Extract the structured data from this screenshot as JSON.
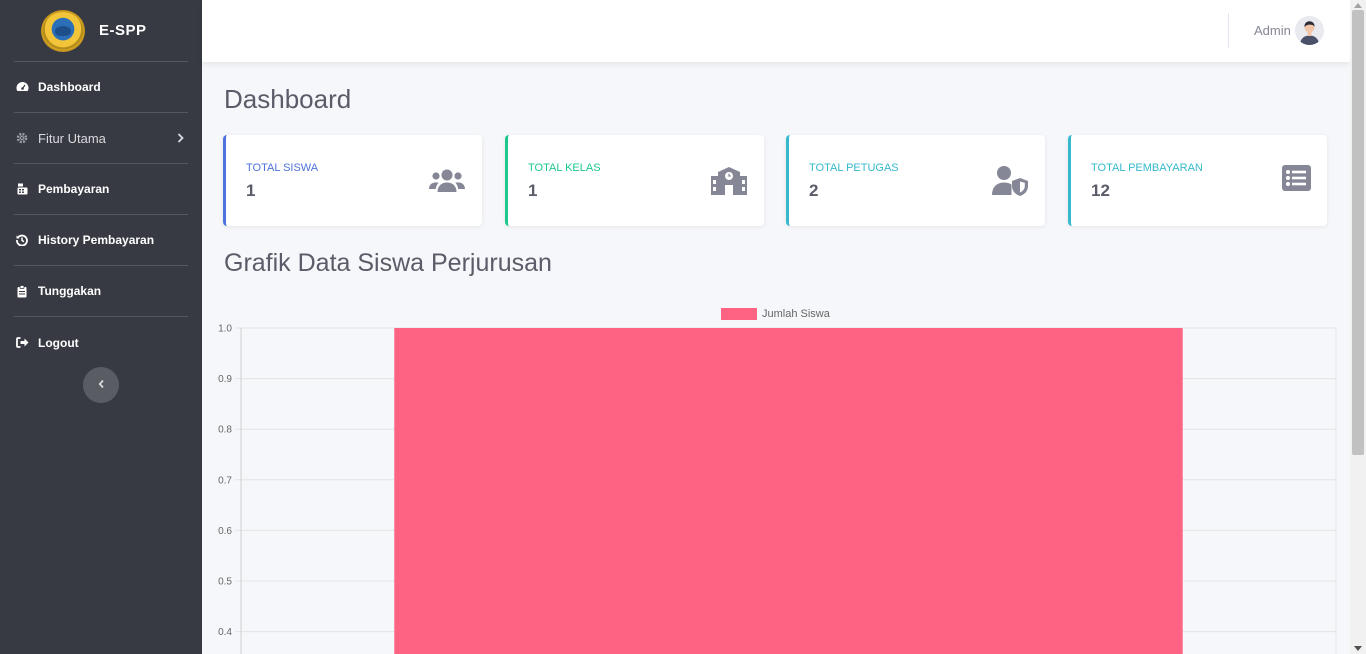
{
  "app": {
    "name": "E-SPP"
  },
  "sidebar": {
    "items": [
      {
        "label": "Dashboard",
        "icon": "tachometer-icon"
      },
      {
        "label": "Fitur Utama",
        "icon": "gear-icon"
      },
      {
        "label": "Pembayaran",
        "icon": "cash-register-icon"
      },
      {
        "label": "History Pembayaran",
        "icon": "history-icon"
      },
      {
        "label": "Tunggakan",
        "icon": "clipboard-icon"
      },
      {
        "label": "Logout",
        "icon": "sign-out-icon"
      }
    ]
  },
  "topbar": {
    "user": "Admin"
  },
  "page": {
    "title": "Dashboard",
    "chart_title": "Grafik Data Siswa Perjurusan"
  },
  "cards": [
    {
      "label": "TOTAL SISWA",
      "value": "1",
      "color": "#4e73df",
      "icon": "users-icon"
    },
    {
      "label": "TOTAL KELAS",
      "value": "1",
      "color": "#1cc88a",
      "icon": "school-icon"
    },
    {
      "label": "TOTAL PETUGAS",
      "value": "2",
      "color": "#36b9cc",
      "icon": "user-shield-icon"
    },
    {
      "label": "TOTAL PEMBAYARAN",
      "value": "12",
      "color": "#36b9cc",
      "icon": "list-alt-icon"
    }
  ],
  "chart_data": {
    "type": "bar",
    "categories": [
      ""
    ],
    "series": [
      {
        "name": "Jumlah Siswa",
        "values": [
          1
        ]
      }
    ],
    "ylim": [
      0,
      1
    ],
    "yticks": [
      "1.0",
      "0.9",
      "0.8",
      "0.7",
      "0.6",
      "0.5",
      "0.4"
    ],
    "bar_color": "#ff6384",
    "legend_position": "top",
    "grid": true
  }
}
